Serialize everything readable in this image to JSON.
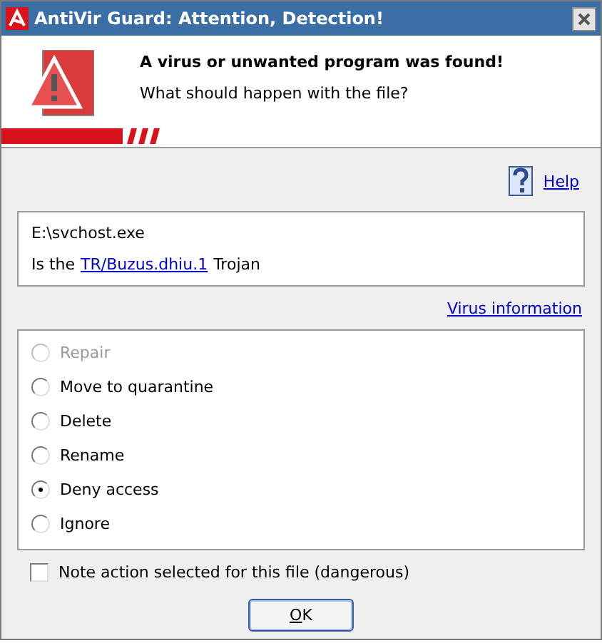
{
  "window": {
    "title": "AntiVir Guard: Attention, Detection!"
  },
  "header": {
    "heading": "A virus or unwanted program was found!",
    "question": "What should happen with the file?"
  },
  "help_link": "Help",
  "detection": {
    "file": "E:\\svchost.exe",
    "prefix": "Is the",
    "virus_link": "TR/Buzus.dhiu.1",
    "suffix": "Trojan"
  },
  "virus_info_link": "Virus information",
  "actions": [
    {
      "label": "Repair",
      "selected": false,
      "disabled": true
    },
    {
      "label": "Move to quarantine",
      "selected": false,
      "disabled": false
    },
    {
      "label": "Delete",
      "selected": false,
      "disabled": false
    },
    {
      "label": "Rename",
      "selected": false,
      "disabled": false
    },
    {
      "label": "Deny access",
      "selected": true,
      "disabled": false
    },
    {
      "label": "Ignore",
      "selected": false,
      "disabled": false
    }
  ],
  "note_checkbox": {
    "label": "Note action selected for this file (dangerous)",
    "checked": false
  },
  "ok_button": "OK"
}
